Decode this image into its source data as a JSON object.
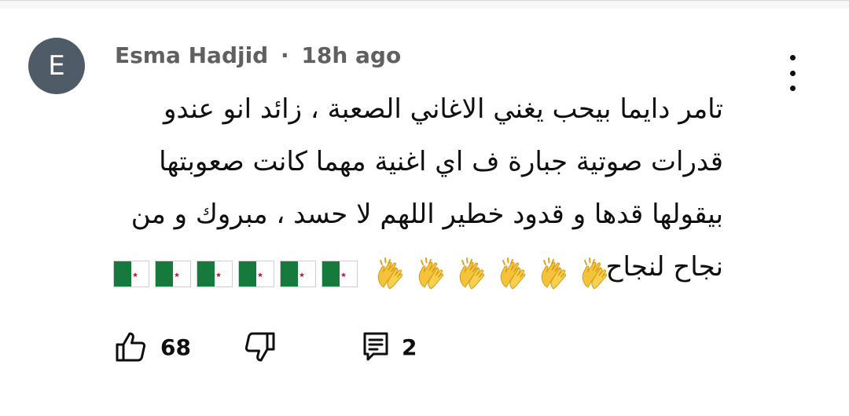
{
  "comment": {
    "avatar_initial": "E",
    "author": "Esma Hadjid",
    "separator": "·",
    "time": "18h ago",
    "text": "تامر دايما بيحب يغني الاغاني الصعبة ، زائد انو عندو قدرات صوتية جبارة ف اي اغنية مهما كانت صعوبتها بيقولها قدها و قدود خطير اللهم لا حسد ، مبروك و من نجاح لنجاح",
    "emoji_flags": 6,
    "emoji_claps": 6,
    "likes": "68",
    "replies": "2"
  },
  "icons": {
    "menu": "more-vert-icon",
    "like": "thumb-up-icon",
    "dislike": "thumb-down-icon",
    "reply": "comment-icon",
    "flag": "algeria-flag-icon",
    "clap": "clapping-hands-icon"
  },
  "colors": {
    "avatar_bg": "#4f5b66",
    "meta_text": "#606060",
    "flag_green": "#157a3c",
    "flag_red": "#d21034",
    "clap_yellow": "#f4c33a"
  }
}
